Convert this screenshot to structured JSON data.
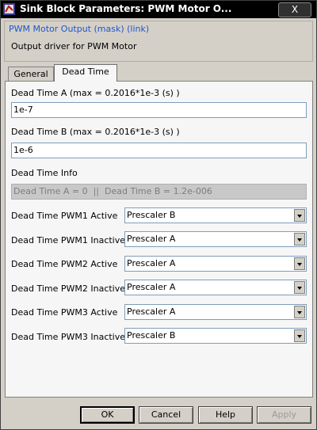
{
  "window": {
    "title": "Sink Block Parameters: PWM Motor O...",
    "close_label": "X"
  },
  "mask": {
    "title": "PWM Motor Output (mask) (link)",
    "description": "Output driver for PWM Motor"
  },
  "tabs": [
    {
      "label": "General"
    },
    {
      "label": "Dead Time",
      "active": true
    }
  ],
  "fields": {
    "dead_time_a": {
      "label": "Dead Time A (max = 0.2016*1e-3 (s) )",
      "value": "1e-7"
    },
    "dead_time_b": {
      "label": "Dead Time B (max = 0.2016*1e-3 (s) )",
      "value": "1e-6"
    },
    "dead_time_info": {
      "label": "Dead Time Info",
      "value": "Dead Time A = 0  ||  Dead Time B = 1.2e-006"
    }
  },
  "selects": [
    {
      "label": "Dead Time PWM1 Active",
      "value": "Prescaler B"
    },
    {
      "label": "Dead Time PWM1 Inactive",
      "value": "Prescaler A"
    },
    {
      "label": "Dead Time PWM2 Active",
      "value": "Prescaler A"
    },
    {
      "label": "Dead Time PWM2 Inactive",
      "value": "Prescaler A"
    },
    {
      "label": "Dead Time PWM3 Active",
      "value": "Prescaler A"
    },
    {
      "label": "Dead Time PWM3 Inactive",
      "value": "Prescaler B"
    }
  ],
  "buttons": {
    "ok": "OK",
    "cancel": "Cancel",
    "help": "Help",
    "apply": "Apply"
  }
}
